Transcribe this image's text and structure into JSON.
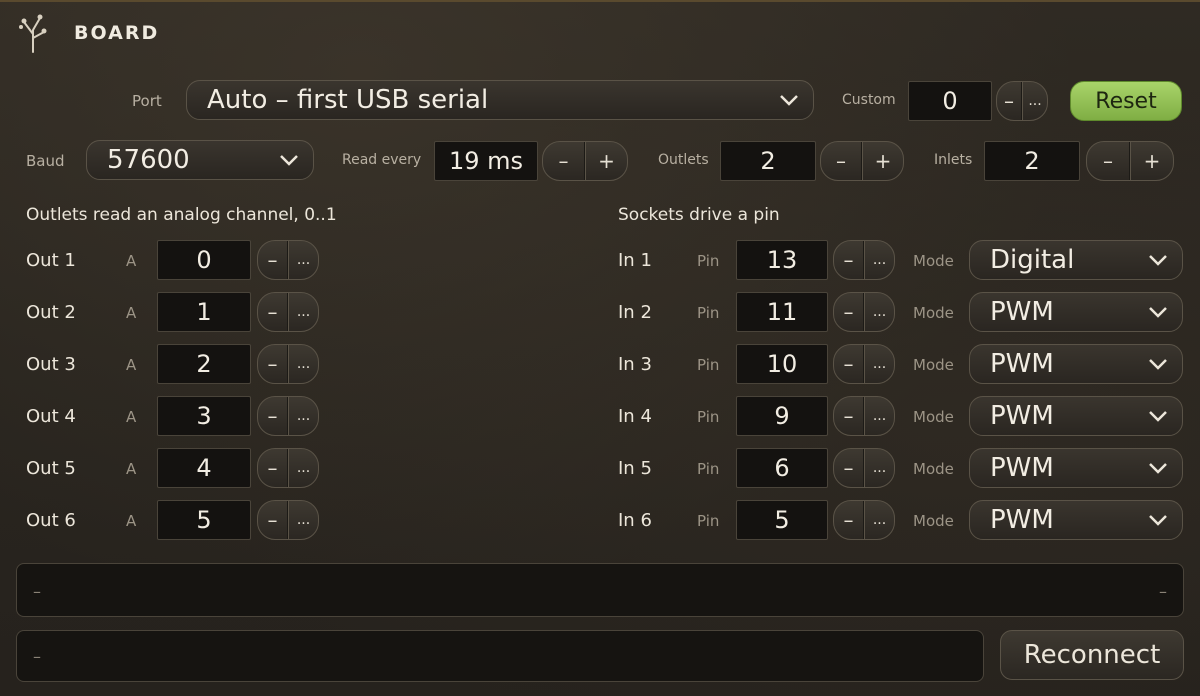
{
  "header": {
    "title": "BOARD",
    "logo_icon": "sprout-icon"
  },
  "port": {
    "label": "Port",
    "value": "Auto – first USB serial"
  },
  "custom": {
    "label": "Custom",
    "value": "0",
    "dec": "–",
    "more": "..."
  },
  "reset_label": "Reset",
  "baud": {
    "label": "Baud",
    "value": "57600"
  },
  "read_every": {
    "label": "Read every",
    "value": "19 ms",
    "dec": "–",
    "inc": "+"
  },
  "outlets": {
    "label": "Outlets",
    "value": "2",
    "dec": "–",
    "inc": "+"
  },
  "inlets": {
    "label": "Inlets",
    "value": "2",
    "dec": "–",
    "inc": "+"
  },
  "outlets_section": "Outlets read an analog channel, 0..1",
  "sockets_section": "Sockets drive a pin",
  "outs": [
    {
      "label": "Out 1",
      "ch": "A",
      "value": "0"
    },
    {
      "label": "Out 2",
      "ch": "A",
      "value": "1"
    },
    {
      "label": "Out 3",
      "ch": "A",
      "value": "2"
    },
    {
      "label": "Out 4",
      "ch": "A",
      "value": "3"
    },
    {
      "label": "Out 5",
      "ch": "A",
      "value": "4"
    },
    {
      "label": "Out 6",
      "ch": "A",
      "value": "5"
    }
  ],
  "ins": [
    {
      "label": "In 1",
      "pin_label": "Pin",
      "pin": "13",
      "mode_label": "Mode",
      "mode": "Digital"
    },
    {
      "label": "In 2",
      "pin_label": "Pin",
      "pin": "11",
      "mode_label": "Mode",
      "mode": "PWM"
    },
    {
      "label": "In 3",
      "pin_label": "Pin",
      "pin": "10",
      "mode_label": "Mode",
      "mode": "PWM"
    },
    {
      "label": "In 4",
      "pin_label": "Pin",
      "pin": "9",
      "mode_label": "Mode",
      "mode": "PWM"
    },
    {
      "label": "In 5",
      "pin_label": "Pin",
      "pin": "6",
      "mode_label": "Mode",
      "mode": "PWM"
    },
    {
      "label": "In 6",
      "pin_label": "Pin",
      "pin": "5",
      "mode_label": "Mode",
      "mode": "PWM"
    }
  ],
  "stepper_small": {
    "dec": "–",
    "more": "..."
  },
  "console_top": {
    "left": "–",
    "right": "–"
  },
  "console_bottom": {
    "left": "–"
  },
  "reconnect_label": "Reconnect",
  "colors": {
    "accent_green": "#94c456",
    "background": "#2a2620"
  }
}
